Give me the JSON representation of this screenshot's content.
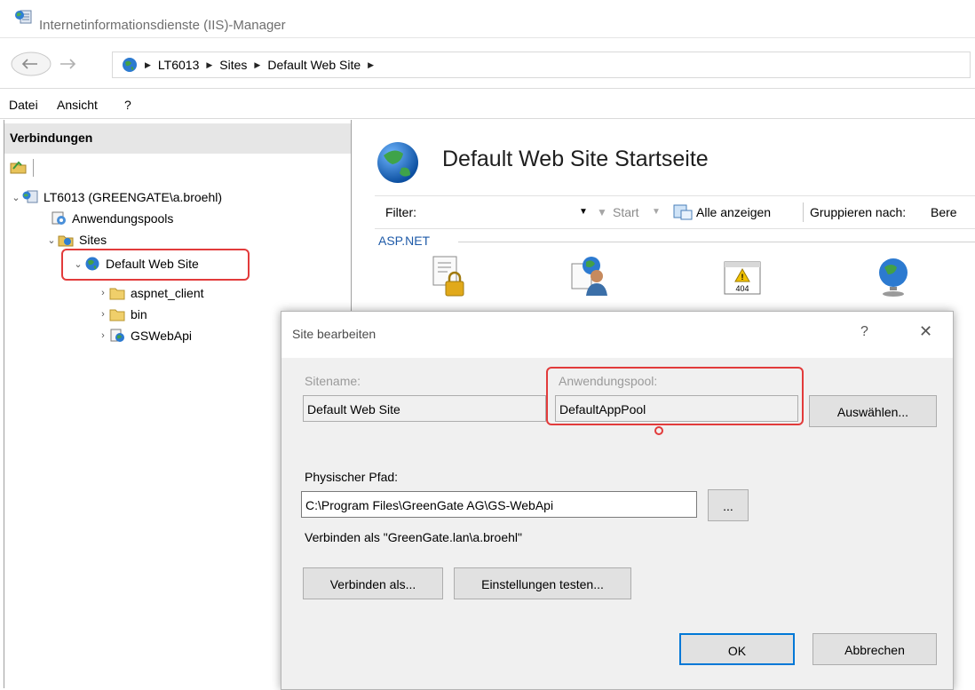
{
  "window": {
    "title": "Internetinformationsdienste (IIS)-Manager"
  },
  "address": {
    "crumbs": [
      "LT6013",
      "Sites",
      "Default Web Site"
    ]
  },
  "menu": {
    "items": [
      "Datei",
      "Ansicht",
      "?"
    ]
  },
  "connections": {
    "header": "Verbindungen",
    "tree": {
      "server": "LT6013 (GREENGATE\\a.broehl)",
      "app_pools": "Anwendungspools",
      "sites": "Sites",
      "default_site": "Default Web Site",
      "children": [
        "aspnet_client",
        "bin",
        "GSWebApi"
      ]
    }
  },
  "home": {
    "title": "Default Web Site Startseite",
    "filter_label": "Filter:",
    "start_label": "Start",
    "show_all_label": "Alle anzeigen",
    "group_label": "Gruppieren nach:",
    "group_value": "Bere",
    "section": "ASP.NET",
    "feature_icons": [
      "lock-doc-icon",
      "user-doc-icon",
      "error-404-icon",
      "globe-icon"
    ],
    "error_badge": "404"
  },
  "dialog": {
    "title": "Site bearbeiten",
    "help": "?",
    "close": "✕",
    "site_name_label": "Sitename:",
    "site_name_value": "Default Web Site",
    "app_pool_label": "Anwendungspool:",
    "app_pool_value": "DefaultAppPool",
    "select_button": "Auswählen...",
    "physical_path_label": "Physischer Pfad:",
    "physical_path_value": "C:\\Program Files\\GreenGate AG\\GS-WebApi",
    "browse_button": "...",
    "connect_as_info": "Verbinden als \"GreenGate.lan\\a.broehl\"",
    "connect_as_button": "Verbinden als...",
    "test_settings_button": "Einstellungen testen...",
    "ok_button": "OK",
    "cancel_button": "Abbrechen"
  },
  "colors": {
    "highlight": "#e23b3b",
    "accent": "#1e5aa8"
  }
}
